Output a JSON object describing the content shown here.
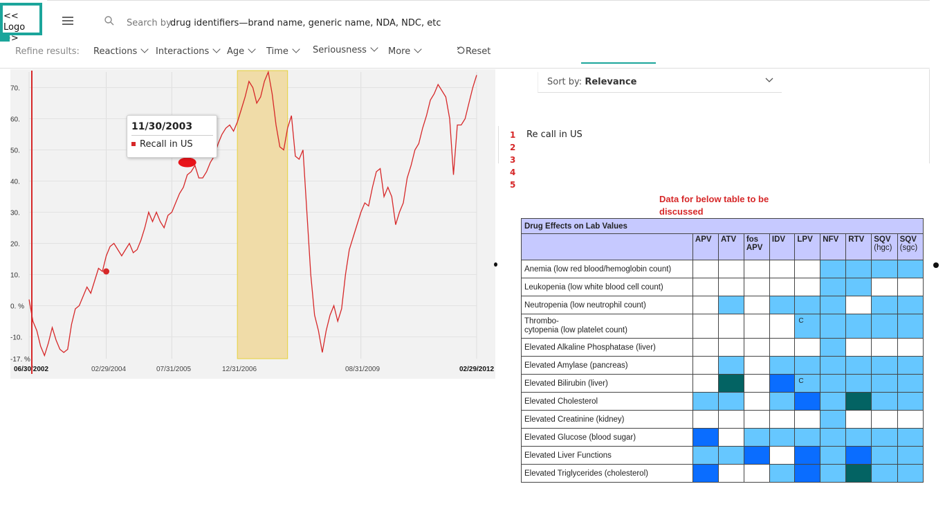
{
  "header": {
    "logo_text": "<< Logo >>",
    "search_placeholder": "Search by drug identifiers—brand name, generic name, NDA, NDC, etc",
    "search_prefix": "Search by",
    "search_rest": "drug identifiers—brand name, generic name, NDA, NDC, etc"
  },
  "filters": {
    "refine_label": "Refine results:",
    "items": [
      "Reactions",
      "Interactions",
      "Age",
      "Time",
      "Seriousness",
      "More"
    ],
    "reset_label": "Reset"
  },
  "sort": {
    "prefix": "Sort by:",
    "value": "Relevance"
  },
  "results": {
    "numbers": [
      "1",
      "2",
      "3",
      "4",
      "5"
    ],
    "first_item": "Re call in US"
  },
  "note": "Data for below table to be discussed",
  "tooltip": {
    "date": "11/30/2003",
    "label": "Recall in US"
  },
  "colors": {
    "accent": "#1ba59b",
    "series": "#d62728",
    "band": "#f0dca8",
    "light_blue": "#66c7ff",
    "blue": "#0a6dff",
    "teal": "#036363",
    "header_bg": "#c6c9ff"
  },
  "chart_data": {
    "type": "line",
    "x_tick_labels": [
      "06/30/2002",
      "02/29/2004",
      "07/31/2005",
      "12/31/2006",
      "08/31/2009",
      "02/29/2012"
    ],
    "y_tick_labels": [
      "70.",
      "60.",
      "50.",
      "40.",
      "30.",
      "20.",
      "10.",
      "0. %",
      "-10.",
      "-17. %"
    ],
    "ylim": [
      -17,
      75
    ],
    "shaded_band": {
      "start": "2006-12",
      "end": "2008-01"
    },
    "markers": [
      {
        "x": "2004-02",
        "y": 11,
        "label": ""
      },
      {
        "x": "2005-11",
        "y": 46,
        "label": "Recall in US"
      }
    ],
    "series": [
      {
        "values": [
          [
            "2002-06",
            2
          ],
          [
            "2002-07",
            -5
          ],
          [
            "2002-08",
            -8
          ],
          [
            "2002-09",
            -13
          ],
          [
            "2002-10",
            -16
          ],
          [
            "2002-11",
            -12
          ],
          [
            "2002-12",
            -7
          ],
          [
            "2003-01",
            -11
          ],
          [
            "2003-02",
            -14
          ],
          [
            "2003-03",
            -15
          ],
          [
            "2003-04",
            -14
          ],
          [
            "2003-05",
            -6
          ],
          [
            "2003-06",
            -1
          ],
          [
            "2003-07",
            0
          ],
          [
            "2003-08",
            3
          ],
          [
            "2003-09",
            6
          ],
          [
            "2003-10",
            4
          ],
          [
            "2003-11",
            8
          ],
          [
            "2003-12",
            12
          ],
          [
            "2004-01",
            11
          ],
          [
            "2004-02",
            16
          ],
          [
            "2004-03",
            19
          ],
          [
            "2004-04",
            20
          ],
          [
            "2004-05",
            18
          ],
          [
            "2004-06",
            16
          ],
          [
            "2004-07",
            18
          ],
          [
            "2004-08",
            20
          ],
          [
            "2004-09",
            17
          ],
          [
            "2004-10",
            18
          ],
          [
            "2004-11",
            21
          ],
          [
            "2004-12",
            25
          ],
          [
            "2005-01",
            30
          ],
          [
            "2005-02",
            27
          ],
          [
            "2005-03",
            30
          ],
          [
            "2005-04",
            27
          ],
          [
            "2005-05",
            25
          ],
          [
            "2005-06",
            29
          ],
          [
            "2005-07",
            30
          ],
          [
            "2005-08",
            33
          ],
          [
            "2005-09",
            36
          ],
          [
            "2005-10",
            38
          ],
          [
            "2005-11",
            42
          ],
          [
            "2005-12",
            43
          ],
          [
            "2006-01",
            45
          ],
          [
            "2006-02",
            41
          ],
          [
            "2006-03",
            41
          ],
          [
            "2006-04",
            43
          ],
          [
            "2006-05",
            46
          ],
          [
            "2006-06",
            48
          ],
          [
            "2006-07",
            52
          ],
          [
            "2006-08",
            55
          ],
          [
            "2006-09",
            57
          ],
          [
            "2006-10",
            58
          ],
          [
            "2006-11",
            56
          ],
          [
            "2006-12",
            59
          ],
          [
            "2007-01",
            63
          ],
          [
            "2007-02",
            67
          ],
          [
            "2007-03",
            72
          ],
          [
            "2007-04",
            70
          ],
          [
            "2007-05",
            65
          ],
          [
            "2007-06",
            67
          ],
          [
            "2007-07",
            72
          ],
          [
            "2007-08",
            75
          ],
          [
            "2007-09",
            68
          ],
          [
            "2007-10",
            58
          ],
          [
            "2007-11",
            51
          ],
          [
            "2007-12",
            50
          ],
          [
            "2008-01",
            57
          ],
          [
            "2008-02",
            61
          ],
          [
            "2008-03",
            48
          ],
          [
            "2008-04",
            47
          ],
          [
            "2008-05",
            50
          ],
          [
            "2008-06",
            30
          ],
          [
            "2008-07",
            10
          ],
          [
            "2008-08",
            -3
          ],
          [
            "2008-09",
            -8
          ],
          [
            "2008-10",
            -15
          ],
          [
            "2008-11",
            -8
          ],
          [
            "2008-12",
            -3
          ],
          [
            "2009-01",
            0
          ],
          [
            "2009-02",
            -5
          ],
          [
            "2009-03",
            -1
          ],
          [
            "2009-04",
            10
          ],
          [
            "2009-05",
            18
          ],
          [
            "2009-06",
            22
          ],
          [
            "2009-07",
            26
          ],
          [
            "2009-08",
            30
          ],
          [
            "2009-09",
            33
          ],
          [
            "2009-10",
            32
          ],
          [
            "2009-11",
            38
          ],
          [
            "2009-12",
            43
          ],
          [
            "2010-01",
            44
          ],
          [
            "2010-02",
            35
          ],
          [
            "2010-03",
            38
          ],
          [
            "2010-04",
            35
          ],
          [
            "2010-05",
            26
          ],
          [
            "2010-06",
            30
          ],
          [
            "2010-07",
            33
          ],
          [
            "2010-08",
            41
          ],
          [
            "2010-09",
            45
          ],
          [
            "2010-10",
            50
          ],
          [
            "2010-11",
            52
          ],
          [
            "2010-12",
            57
          ],
          [
            "2011-01",
            61
          ],
          [
            "2011-02",
            66
          ],
          [
            "2011-03",
            68
          ],
          [
            "2011-04",
            71
          ],
          [
            "2011-05",
            69
          ],
          [
            "2011-06",
            67
          ],
          [
            "2011-07",
            60
          ],
          [
            "2011-08",
            42
          ],
          [
            "2011-09",
            58
          ],
          [
            "2011-10",
            58
          ],
          [
            "2011-11",
            60
          ],
          [
            "2011-12",
            65
          ],
          [
            "2012-01",
            70
          ],
          [
            "2012-02",
            74
          ]
        ]
      }
    ]
  },
  "table": {
    "title": "Drug Effects on Lab Values",
    "columns": [
      {
        "name": "APV",
        "sub": ""
      },
      {
        "name": "ATV",
        "sub": ""
      },
      {
        "name": "fos APV",
        "sub": ""
      },
      {
        "name": "IDV",
        "sub": ""
      },
      {
        "name": "LPV",
        "sub": ""
      },
      {
        "name": "NFV",
        "sub": ""
      },
      {
        "name": "RTV",
        "sub": ""
      },
      {
        "name": "SQV",
        "sub": "(hgc)"
      },
      {
        "name": "SQV",
        "sub": "(sgc)"
      }
    ],
    "rows": [
      {
        "label": "Anemia (low red blood/hemoglobin count)",
        "cells": [
          "w",
          "w",
          "w",
          "w",
          "w",
          "l",
          "l",
          "l",
          "l"
        ],
        "marks": [
          "",
          "",
          "",
          "",
          "",
          "",
          "",
          "",
          ""
        ]
      },
      {
        "label": "Leukopenia (low white blood cell count)",
        "cells": [
          "w",
          "w",
          "w",
          "w",
          "w",
          "l",
          "l",
          "w",
          "w"
        ],
        "marks": [
          "",
          "",
          "",
          "",
          "",
          "",
          "",
          "",
          ""
        ]
      },
      {
        "label": "Neutropenia (low neutrophil count)",
        "cells": [
          "w",
          "l",
          "w",
          "l",
          "l",
          "l",
          "w",
          "l",
          "l"
        ],
        "marks": [
          "",
          "",
          "",
          "",
          "",
          "",
          "",
          "",
          ""
        ]
      },
      {
        "label": "Thrombo-cytopenia (low platelet count)",
        "cells": [
          "w",
          "w",
          "w",
          "w",
          "l",
          "l",
          "l",
          "l",
          "l"
        ],
        "marks": [
          "",
          "",
          "",
          "",
          "C",
          "",
          "",
          "",
          ""
        ]
      },
      {
        "label": "Elevated Alkaline Phosphatase (liver)",
        "cells": [
          "w",
          "w",
          "w",
          "w",
          "w",
          "l",
          "w",
          "w",
          "w"
        ],
        "marks": [
          "",
          "",
          "",
          "",
          "",
          "",
          "",
          "",
          ""
        ]
      },
      {
        "label": "Elevated Amylase (pancreas)",
        "cells": [
          "w",
          "l",
          "w",
          "l",
          "l",
          "l",
          "l",
          "l",
          "l"
        ],
        "marks": [
          "",
          "",
          "",
          "",
          "",
          "",
          "",
          "",
          ""
        ]
      },
      {
        "label": "Elevated Bilirubin (liver)",
        "cells": [
          "w",
          "t",
          "w",
          "b",
          "l",
          "l",
          "l",
          "l",
          "l"
        ],
        "marks": [
          "",
          "",
          "",
          "",
          "C",
          "",
          "",
          "",
          ""
        ]
      },
      {
        "label": "Elevated Cholesterol",
        "cells": [
          "l",
          "l",
          "w",
          "l",
          "b",
          "l",
          "t",
          "l",
          "l"
        ],
        "marks": [
          "",
          "",
          "",
          "",
          "",
          "",
          "",
          "",
          ""
        ]
      },
      {
        "label": "Elevated Creatinine (kidney)",
        "cells": [
          "w",
          "w",
          "w",
          "w",
          "w",
          "l",
          "w",
          "w",
          "w"
        ],
        "marks": [
          "",
          "",
          "",
          "",
          "",
          "",
          "",
          "",
          ""
        ]
      },
      {
        "label": "Elevated Glucose (blood sugar)",
        "cells": [
          "b",
          "w",
          "l",
          "l",
          "l",
          "l",
          "l",
          "l",
          "l"
        ],
        "marks": [
          "",
          "",
          "",
          "",
          "",
          "",
          "",
          "",
          ""
        ]
      },
      {
        "label": "Elevated Liver Functions",
        "cells": [
          "l",
          "l",
          "b",
          "w",
          "b",
          "l",
          "b",
          "l",
          "l"
        ],
        "marks": [
          "",
          "",
          "",
          "",
          "",
          "",
          "",
          "",
          ""
        ]
      },
      {
        "label": "Elevated Triglycerides (cholesterol)",
        "cells": [
          "b",
          "w",
          "w",
          "l",
          "b",
          "l",
          "t",
          "l",
          "l"
        ],
        "marks": [
          "",
          "",
          "",
          "",
          "",
          "",
          "",
          "",
          ""
        ]
      }
    ]
  }
}
